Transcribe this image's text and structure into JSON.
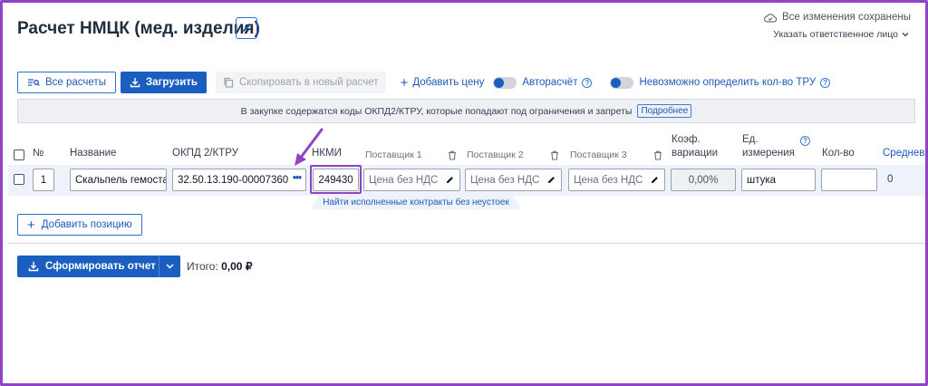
{
  "header": {
    "title": "Расчет НМЦК (мед. изделия)",
    "saved_status": "Все изменения сохранены",
    "responsible_label": "Указать ответственное лицо"
  },
  "toolbar": {
    "all_calcs_label": "Все расчеты",
    "upload_label": "Загрузить",
    "copy_label": "Скопировать в новый расчет",
    "add_price_label": "Добавить цену",
    "autocalc_label": "Авторасчёт",
    "tru_label": "Невозможно определить кол-во ТРУ"
  },
  "banner": {
    "text": "В закупке содержатся коды ОКПД2/КТРУ, которые попадают под ограничения и запреты",
    "link": "Подробнее"
  },
  "table": {
    "headers": {
      "num": "№",
      "name": "Название",
      "okpd": "ОКПД 2/КТРУ",
      "nkmi": "НКМИ",
      "supplier1": "Поставщик 1",
      "supplier2": "Поставщик 2",
      "supplier3": "Поставщик 3",
      "coef_line1": "Коэф.",
      "coef_line2": "вариации",
      "unit_line1": "Ед.",
      "unit_line2": "измерения",
      "qty": "Кол-во",
      "avg": "Средневз"
    },
    "row": {
      "num": "1",
      "name": "Скальпель гемостатический",
      "okpd": "32.50.13.190-00007360",
      "nkmi": "249430",
      "supplier_placeholder": "Цена без НДС",
      "coef": "0,00%",
      "unit": "штука",
      "qty": "",
      "avg": "0"
    },
    "hint": "Найти исполненные контракты без неустоек"
  },
  "footer": {
    "add_position_label": "Добавить позицию",
    "report_label": "Сформировать отчет",
    "total_label": "Итого:",
    "total_value": "0,00 ₽"
  },
  "colors": {
    "primary": "#1a5fc0",
    "accent_annotation": "#8e44c4",
    "row_highlight": "#eef2fb"
  }
}
